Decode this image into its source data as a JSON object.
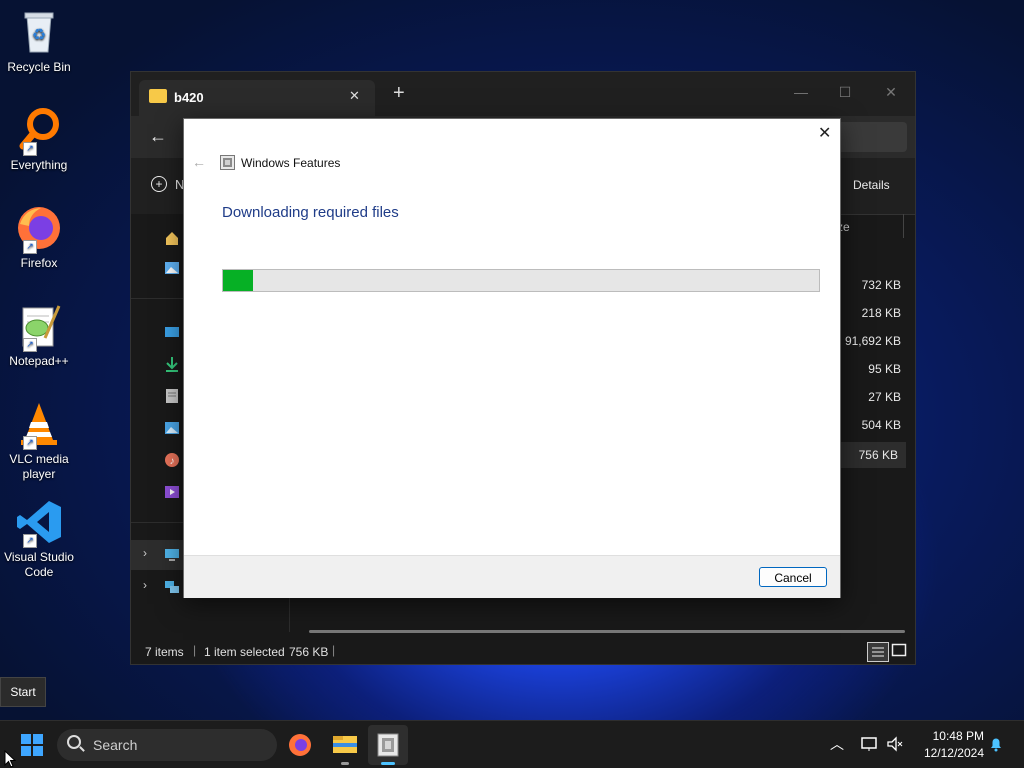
{
  "desktop": {
    "icons": [
      {
        "label": "Recycle Bin"
      },
      {
        "label": "Everything"
      },
      {
        "label": "Firefox"
      },
      {
        "label": "Notepad++"
      },
      {
        "label": "VLC media player"
      },
      {
        "label": "Visual Studio Code"
      }
    ],
    "start_tooltip": "Start"
  },
  "explorer": {
    "tab_title": "b420",
    "new_tab_glyph": "+",
    "close_tab_glyph": "✕",
    "new_button_partial": "N",
    "details_label": "Details",
    "size_header_partial": "ze",
    "sizes": [
      "732 KB",
      "218 KB",
      "91,692 KB",
      "95 KB",
      "27 KB",
      "504 KB",
      "756 KB"
    ],
    "status": {
      "items": "7 items",
      "selected": "1 item selected",
      "selected_size": "756 KB"
    }
  },
  "dialog": {
    "title": "Windows Features",
    "heading": "Downloading required files",
    "progress_percent": 5,
    "cancel_label": "Cancel",
    "close_glyph": "✕"
  },
  "taskbar": {
    "search_label": "Search",
    "time": "10:48 PM",
    "date": "12/12/2024"
  },
  "colors": {
    "accent": "#0067c0",
    "heading": "#1f3c88",
    "progress_fill": "#06b025"
  }
}
